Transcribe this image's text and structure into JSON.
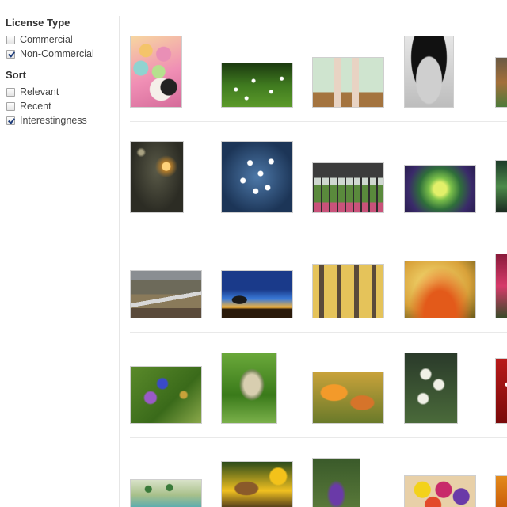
{
  "filters": {
    "license": {
      "title": "License Type",
      "options": [
        {
          "label": "Commercial",
          "checked": false
        },
        {
          "label": "Non-Commercial",
          "checked": true
        }
      ]
    },
    "sort": {
      "title": "Sort",
      "options": [
        {
          "label": "Relevant",
          "checked": false
        },
        {
          "label": "Recent",
          "checked": false
        },
        {
          "label": "Interestingness",
          "checked": true
        }
      ]
    }
  },
  "results": {
    "rows": [
      [
        "skull-girl-flowers",
        "daisy-field",
        "legs-white-boots",
        "feather-headdress-portrait",
        "partial-image"
      ],
      [
        "dandelion-dark",
        "blue-daisies",
        "greenhouse-garden",
        "green-succulent",
        "partial-image"
      ],
      [
        "mountain-stream",
        "lone-tree-sunset",
        "yellow-building-windows",
        "orange-flower-closeup",
        "partial-image"
      ],
      [
        "hummingbird-blue-flower",
        "hummingbird-perched",
        "orange-lily",
        "white-orchids",
        "partial-image"
      ],
      [
        "miniature-landscape",
        "butterfly-sunflower",
        "purple-lupine",
        "colorful-flower-bouquet",
        "partial-image"
      ]
    ]
  }
}
